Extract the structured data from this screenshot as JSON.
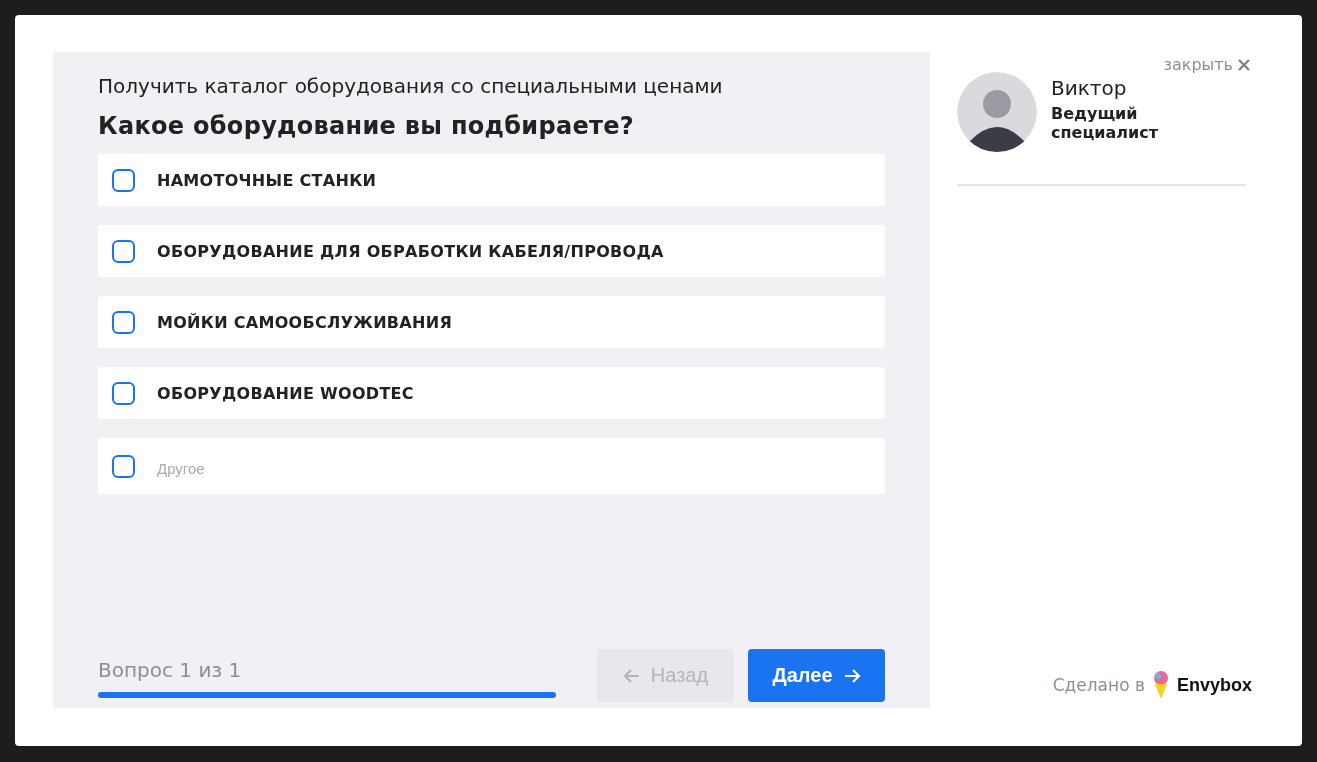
{
  "title": "Получить каталог оборудования со специальными ценами",
  "question": "Какое оборудование вы подбираете?",
  "options": [
    {
      "kind": "checkbox",
      "label": "НАМОТОЧНЫЕ СТАНКИ",
      "checked": false
    },
    {
      "kind": "checkbox",
      "label": "ОБОРУДОВАНИЕ ДЛЯ ОБРАБОТКИ КАБЕЛЯ/ПРОВОДА",
      "checked": false
    },
    {
      "kind": "checkbox",
      "label": "МОЙКИ САМООБСЛУЖИВАНИЯ",
      "checked": false
    },
    {
      "kind": "checkbox",
      "label": "ОБОРУДОВАНИЕ WOODTEC",
      "checked": false
    },
    {
      "kind": "other",
      "placeholder": "Другое",
      "checked": false
    }
  ],
  "progress": {
    "label": "Вопрос 1 из 1",
    "level": 1
  },
  "buttons": {
    "back": {
      "label": "Назад",
      "disabled": true
    },
    "next": {
      "label": "Далее",
      "disabled": false
    }
  },
  "close": {
    "label": "закрыть"
  },
  "consultant": {
    "name": "Виктор",
    "role": "Ведущий специалист"
  },
  "footer": {
    "made_in": "Сделано в",
    "brand": "Envybox"
  }
}
